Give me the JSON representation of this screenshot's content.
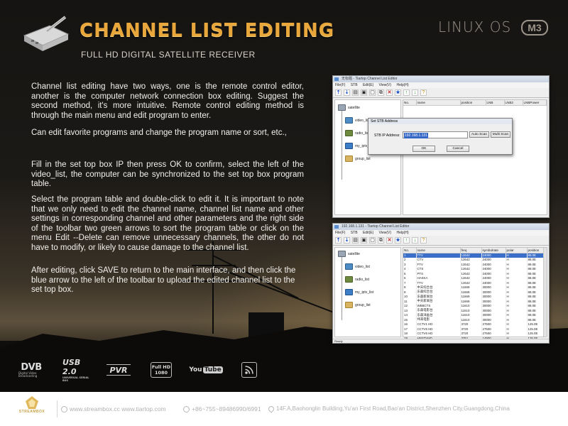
{
  "header": {
    "title": "CHANNEL LIST EDITING",
    "subtitle": "FULL HD DIGITAL SATELLITE RECEIVER",
    "os_label": "LINUX OS",
    "model_badge": "M3"
  },
  "description": {
    "p1": "Channel list editing have two ways, one is the remote control editor, another is the computer network connection box editing. Suggest the second method, it's more intuitive. Remote control editing method is through the main menu and edit program to enter.",
    "p2": "Can edit favorite programs and change the program name or sort, etc.,",
    "p3": "Fill in the set top box IP then press OK to confirm, select the left of the video_list, the computer can be synchronized to the set top box program table.",
    "p4": "Select the program table and double-click to edit it. It is important to note that we only need to edit the channel name, channel list name and other settings in corresponding channel and other parameters and the right side of the toolbar two green arrows to sort the program table or click on the menu Edit --Delete can remove unnecessary channels, the other do not have to modify, or likely to cause damage to the channel list.",
    "p5": "After editing, click SAVE to return to the main interface, and then click the blue arrow to the left of the toolbar to upload the edited channel list to the set top box."
  },
  "window1": {
    "title": "无标题 - Tiartop Channel List Editor",
    "menu": [
      "File(F)",
      "STB",
      "Edit(E)",
      "View(V)",
      "Help(H)"
    ],
    "tree": [
      "satellite",
      "video_list",
      "radio_list",
      "my_iptv_list",
      "group_list"
    ],
    "columns": [
      "No.",
      "name",
      "position",
      "LNB",
      "LNB2",
      "LNBPower"
    ],
    "dialog": {
      "title": "Set STB Address",
      "label": "STB IP Address:",
      "ip_value": "192.168.1.131",
      "auto_scan": "Auto Scan",
      "multi_scan": "Multi Scan",
      "ok": "OK",
      "cancel": "Cancel"
    }
  },
  "window2": {
    "title": "192.168.1.131 - Tiartop Channel List Editor",
    "menu": [
      "File(F)",
      "STB",
      "Edit(E)",
      "View(V)",
      "Help(H)"
    ],
    "tree": [
      "satellite",
      "video_list",
      "radio_list",
      "my_iptv_list",
      "group_list"
    ],
    "columns": [
      "No.",
      "name",
      "freq",
      "symbolrate",
      "polar",
      "position"
    ],
    "rows": [
      [
        "1",
        "TTV",
        "12642",
        "24000",
        "H",
        "88.0E"
      ],
      [
        "2",
        "CTV",
        "12642",
        "24000",
        "H",
        "88.0E"
      ],
      [
        "3",
        "FTV",
        "12642",
        "24000",
        "H",
        "88.0E"
      ],
      [
        "4",
        "CTS",
        "12642",
        "24000",
        "H",
        "88.0E"
      ],
      [
        "5",
        "PTS",
        "12642",
        "24000",
        "H",
        "88.0E"
      ],
      [
        "6",
        "HAKKA",
        "12642",
        "24000",
        "H",
        "88.0E"
      ],
      [
        "7",
        "TTV",
        "12642",
        "24000",
        "H",
        "88.0E"
      ],
      [
        "8",
        "中天综合台",
        "11669",
        "30000",
        "H",
        "88.0E"
      ],
      [
        "9",
        "东森综合台",
        "11669",
        "30000",
        "H",
        "88.0E"
      ],
      [
        "10",
        "东森新闻台",
        "11669",
        "30000",
        "H",
        "88.0E"
      ],
      [
        "11",
        "中天新闻台",
        "11669",
        "30000",
        "H",
        "88.0E"
      ],
      [
        "12",
        "WBBCTS",
        "11610",
        "30000",
        "H",
        "88.0E"
      ],
      [
        "13",
        "东森电影台",
        "11610",
        "30000",
        "H",
        "88.0E"
      ],
      [
        "14",
        "东森洋画台",
        "11610",
        "30000",
        "H",
        "88.0E"
      ],
      [
        "15",
        "纬来电影",
        "11610",
        "30000",
        "H",
        "88.0E"
      ],
      [
        "16",
        "CCTV1 HD",
        "3720",
        "27500",
        "H",
        "125.0E"
      ],
      [
        "17",
        "CCTV5 HD",
        "3720",
        "27500",
        "H",
        "125.0E"
      ],
      [
        "18",
        "CCTV6 HD",
        "3720",
        "27500",
        "H",
        "125.0E"
      ],
      [
        "19",
        "HNSTVHD",
        "3751",
        "14900",
        "H",
        "125.0E"
      ],
      [
        "20",
        "HNSTVHD+",
        "3751",
        "14900",
        "H",
        "125.0E"
      ]
    ],
    "status": "Ready"
  },
  "badges": {
    "dvb": "DVB",
    "dvb_sub": "Digital Video Broadcasting",
    "usb": "USB 2.0",
    "usb_sub": "UNIVERSAL SERIAL BUS",
    "pvr": "PVR",
    "fhd_top": "Full HD",
    "fhd_bottom": "1080",
    "youtube_you": "You",
    "youtube_tube": "Tube"
  },
  "footer": {
    "brand": "STREAMBOX",
    "website": "www.streambox.cc  www.tiartop.com",
    "phone": "+86~755~89486990/6991",
    "address": "14F.A,Baohonglin Building,Yu'an First Road,Bao'an District,Shenzhen City,Guangdong,China"
  },
  "colors": {
    "title_gold": "#e9a63a",
    "selected_row": "#3a6ec8"
  }
}
